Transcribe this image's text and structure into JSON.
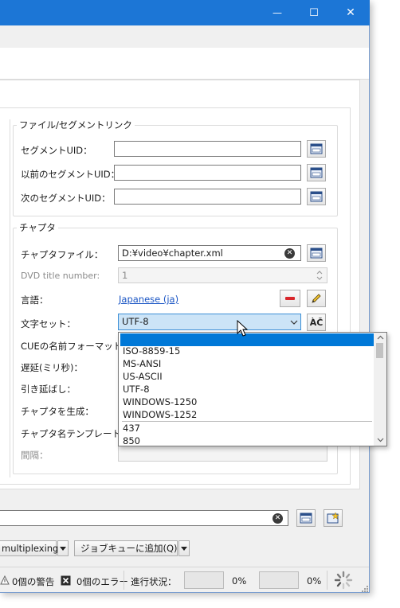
{
  "window": {
    "minimize_glyph": "—",
    "maximize_glyph": "☐",
    "close_glyph": "✕"
  },
  "file_segment": {
    "title": "ファイル/セグメントリンク",
    "segment_uid_label": "セグメントUID：",
    "prev_segment_uid_label": "以前のセグメントUID：",
    "next_segment_uid_label": "次のセグメントUID：",
    "segment_uid_value": "",
    "prev_segment_uid_value": "",
    "next_segment_uid_value": ""
  },
  "chapter": {
    "title": "チャプタ",
    "chapter_file_label": "チャプタファイル：",
    "chapter_file_value": "D:¥video¥chapter.xml",
    "dvd_title_label": "DVD title number:",
    "dvd_title_value": "1",
    "language_label": "言語：",
    "language_value": "Japanese (ja)",
    "charset_label": "文字セット：",
    "charset_value": "UTF-8",
    "charset_btn_glyph": "ÀČ",
    "cue_label": "CUEの名前フォーマット：",
    "delay_label": "遅延(ミリ秒)：",
    "stretch_label": "引き延ばし：",
    "generate_label": "チャプタを生成：",
    "template_label": "チャプタ名テンプレート：",
    "interval_label": "間隔："
  },
  "charset_dropdown": {
    "options": [
      "",
      "ISO-8859-15",
      "MS-ANSI",
      "US-ASCII",
      "UTF-8",
      "WINDOWS-1250",
      "WINDOWS-1252",
      "437",
      "850"
    ]
  },
  "bottom": {
    "mux_label": "multiplexing",
    "add_job_label": "ジョブキューに追加(Q)",
    "warnings": "0個の警告",
    "errors": "0個のエラー",
    "progress_label": "進行状況：",
    "progress1": "0%",
    "progress2": "0%",
    "progress1_value": 0,
    "progress2_value": 0
  },
  "colors": {
    "titlebar": "#1c76d6",
    "selection": "#0078d7",
    "link": "#1a55c4"
  }
}
